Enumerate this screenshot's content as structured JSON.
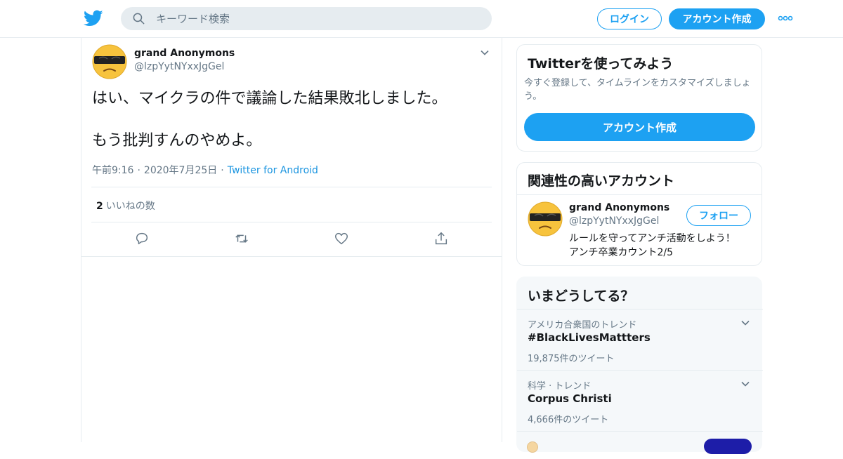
{
  "header": {
    "search_placeholder": "キーワード検索",
    "login_label": "ログイン",
    "signup_label": "アカウント作成",
    "accent": "#1da1f2"
  },
  "tweet": {
    "author_name": "grand Anonymons",
    "author_handle": "@lzpYytNYxxJgGel",
    "text": "はい、マイクラの件で議論した結果敗北しました。\n\nもう批判すんのやめよ。",
    "time": "午前9:16",
    "date": "2020年7月25日",
    "source": "Twitter for Android",
    "likes_count": "2",
    "likes_label": "いいねの数",
    "actions": [
      "reply-icon",
      "retweet-icon",
      "like-icon",
      "share-icon"
    ]
  },
  "signup_card": {
    "title": "Twitterを使ってみよう",
    "description": "今すぐ登録して、タイムラインをカスタマイズしましょう。",
    "button_label": "アカウント作成"
  },
  "related": {
    "title": "関連性の高いアカウント",
    "account": {
      "name": "grand Anonymons",
      "handle": "@lzpYytNYxxJgGel",
      "follow_label": "フォロー",
      "bio": "ルールを守ってアンチ活動をしよう！\nアンチ卒業カウント2/5"
    }
  },
  "trends": {
    "title": "いまどうしてる？",
    "items": [
      {
        "context": "アメリカ合衆国のトレンド",
        "name": "#BlackLivesMattters",
        "count": "19,875件のツイート"
      },
      {
        "context": "科学 · トレンド",
        "name": "Corpus Christi",
        "count": "4,666件のツイート"
      }
    ]
  }
}
